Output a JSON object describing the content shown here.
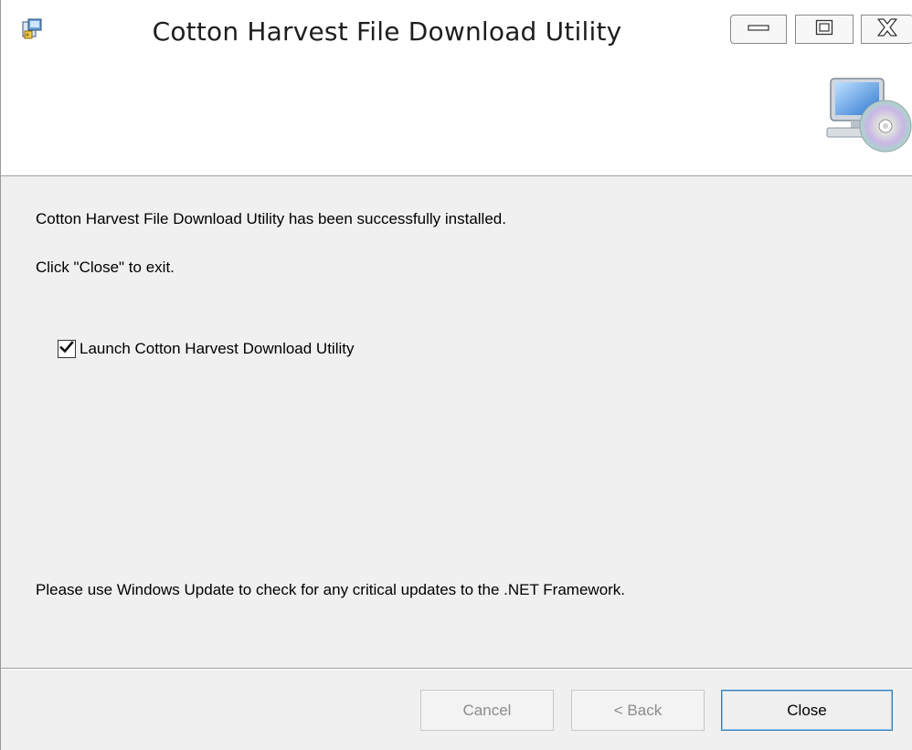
{
  "window": {
    "title": "Cotton Harvest File Download Utility",
    "controls": {
      "minimize_icon": "minimize-icon",
      "maximize_icon": "maximize-icon",
      "close_icon": "close-icon"
    }
  },
  "content": {
    "success_message": "Cotton Harvest File Download Utility has been successfully installed.",
    "exit_instruction": "Click \"Close\" to exit.",
    "launch_checkbox": {
      "label": "Launch Cotton Harvest Download Utility",
      "checked": true
    },
    "update_notice": "Please use Windows Update to check for any critical updates to the .NET Framework."
  },
  "footer": {
    "cancel_label": "Cancel",
    "back_label": "< Back",
    "close_label": "Close",
    "cancel_enabled": false,
    "back_enabled": false,
    "close_enabled": true
  },
  "colors": {
    "window_bg": "#f0f0f0",
    "banner_bg": "#ffffff",
    "default_button_border": "#3c7fb1",
    "disabled_text": "#8c8c8c"
  }
}
